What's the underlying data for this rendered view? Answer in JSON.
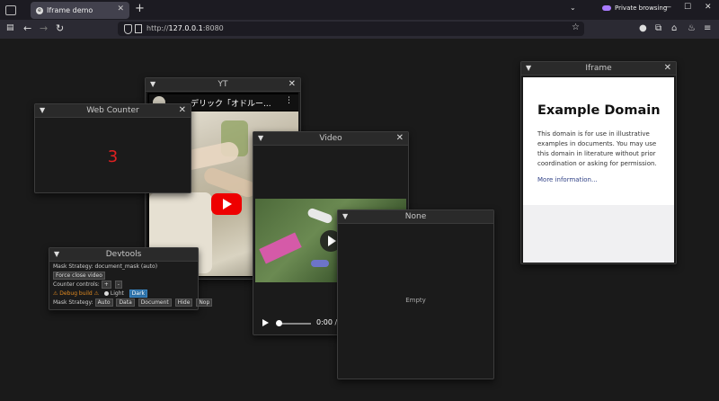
{
  "browser": {
    "tab_title": "Iframe demo",
    "tab_favicon": "e",
    "new_tab": "+",
    "private_label": "Private browsing",
    "url_scheme": "http://",
    "url_host": "127.0.0.1",
    "url_port": ":8080",
    "min": "—",
    "max": "☐",
    "close": "✕",
    "tabs_menu": "⌄"
  },
  "windows": {
    "yt": {
      "title": "YT",
      "video_title": "デリック「オドルー...",
      "menu": "⋮"
    },
    "counter": {
      "title": "Web Counter",
      "value": "3"
    },
    "video": {
      "title": "Video",
      "time": "0:00 / 0:"
    },
    "none": {
      "title": "None",
      "empty": "Empty"
    },
    "iframe": {
      "title": "Iframe",
      "heading": "Example Domain",
      "paragraph": "This domain is for use in illustrative examples in documents. You may use this domain in literature without prior coordination or asking for permission.",
      "link": "More information..."
    },
    "devtools": {
      "title": "Devtools",
      "mask_strategy_line": "Mask Strategy: document_mask (auto)",
      "force_close": "Force close video",
      "counter_controls": "Counter controls:",
      "plus": "+",
      "minus": "-",
      "debug_build": "⚠ Debug build ⚠",
      "light": "Light",
      "dark": "Dark",
      "mask_strategy_label": "Mask Strategy:",
      "strategies": [
        "Auto",
        "Data",
        "Document",
        "Hide",
        "Nop"
      ]
    }
  },
  "window_controls": {
    "collapse": "▼",
    "close": "✕"
  }
}
